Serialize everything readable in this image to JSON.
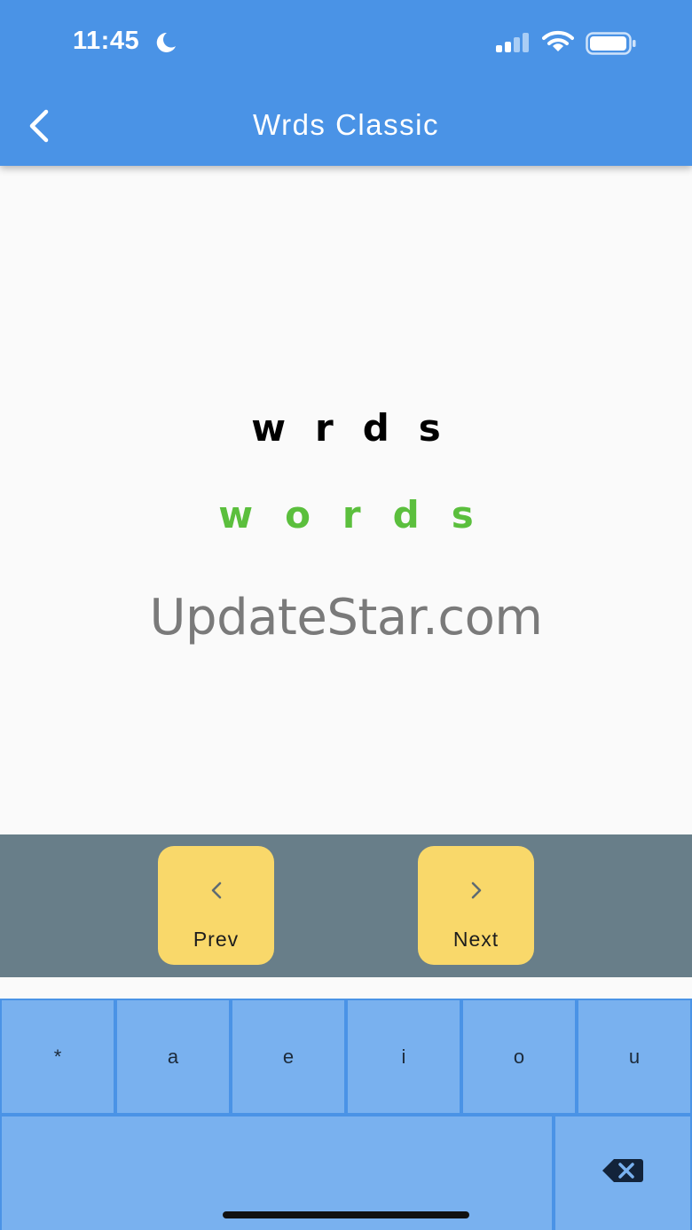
{
  "status_bar": {
    "time": "11:45",
    "icons": [
      "moon-icon",
      "signal-icon",
      "wifi-icon",
      "battery-icon"
    ]
  },
  "app_bar": {
    "title": "Wrds Classic",
    "back_icon": "chevron-left-icon"
  },
  "puzzle": {
    "hint_word": "wrds",
    "answer_word": "words"
  },
  "watermark": "UpdateStar.com",
  "navigation": {
    "prev_label": "Prev",
    "next_label": "Next"
  },
  "keyboard": {
    "keys": [
      "*",
      "a",
      "e",
      "i",
      "o",
      "u"
    ],
    "delete_icon": "backspace-icon"
  },
  "colors": {
    "app_bar": "#4a93e6",
    "answer_text": "#5bbf3d",
    "nav_button": "#f9d86a",
    "nav_bar": "#687e89",
    "key": "#79b1ef"
  }
}
